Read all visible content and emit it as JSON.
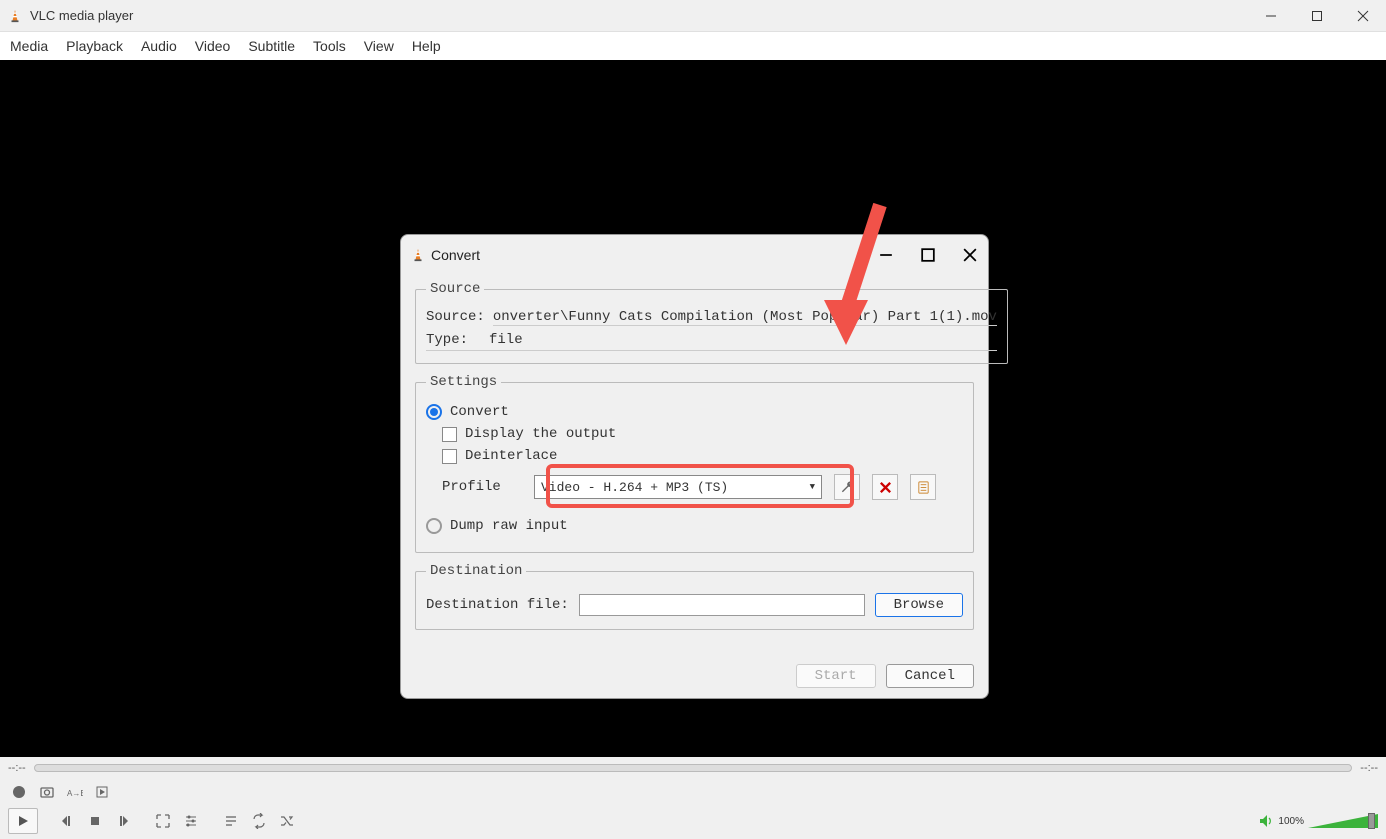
{
  "window": {
    "title": "VLC media player"
  },
  "menu": {
    "media": "Media",
    "playback": "Playback",
    "audio": "Audio",
    "video": "Video",
    "subtitle": "Subtitle",
    "tools": "Tools",
    "view": "View",
    "help": "Help"
  },
  "seek": {
    "elapsed": "--:--",
    "remaining": "--:--"
  },
  "volume": {
    "percent": "100%"
  },
  "dialog": {
    "title": "Convert",
    "source_legend": "Source",
    "source_label": "Source:",
    "source_path": "onverter\\Funny Cats Compilation (Most Popular) Part 1(1).mov",
    "type_label": "Type:",
    "type_value": "file",
    "settings_legend": "Settings",
    "convert_label": "Convert",
    "display_output_label": "Display the output",
    "deinterlace_label": "Deinterlace",
    "profile_label": "Profile",
    "profile_value": "Video - H.264 + MP3 (TS)",
    "dump_label": "Dump raw input",
    "dest_legend": "Destination",
    "dest_file_label": "Destination file:",
    "browse_label": "Browse",
    "start_label": "Start",
    "cancel_label": "Cancel"
  }
}
